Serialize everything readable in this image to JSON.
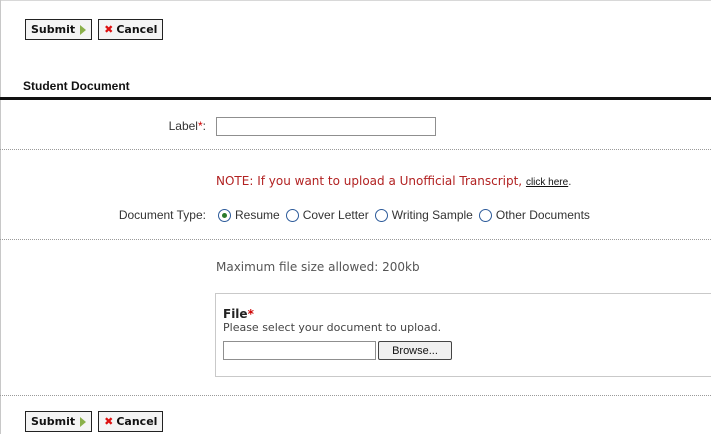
{
  "toolbar": {
    "submit_label": "Submit",
    "cancel_label": "Cancel"
  },
  "section": {
    "title": "Student Document"
  },
  "form": {
    "label_field": {
      "label": "Label",
      "required_mark": "*",
      "suffix": ":",
      "value": ""
    },
    "note": {
      "text": "NOTE: If you want to upload a Unofficial Transcript,",
      "link": "click here",
      "end": "."
    },
    "document_type": {
      "label": "Document Type:",
      "options": [
        "Resume",
        "Cover Letter",
        "Writing Sample",
        "Other Documents"
      ],
      "selected": "Resume"
    },
    "max_size": "Maximum file size allowed: 200kb",
    "file": {
      "title": "File",
      "required_mark": "*",
      "help": "Please select your document to upload.",
      "browse_label": "Browse..."
    }
  },
  "colors": {
    "note_red": "#b22222",
    "required_red": "#cc0000",
    "submit_arrow": "#8ab04a",
    "cancel_x": "#dd1111"
  },
  "icons": {
    "submit": "arrow-right-icon",
    "cancel": "x-icon"
  }
}
